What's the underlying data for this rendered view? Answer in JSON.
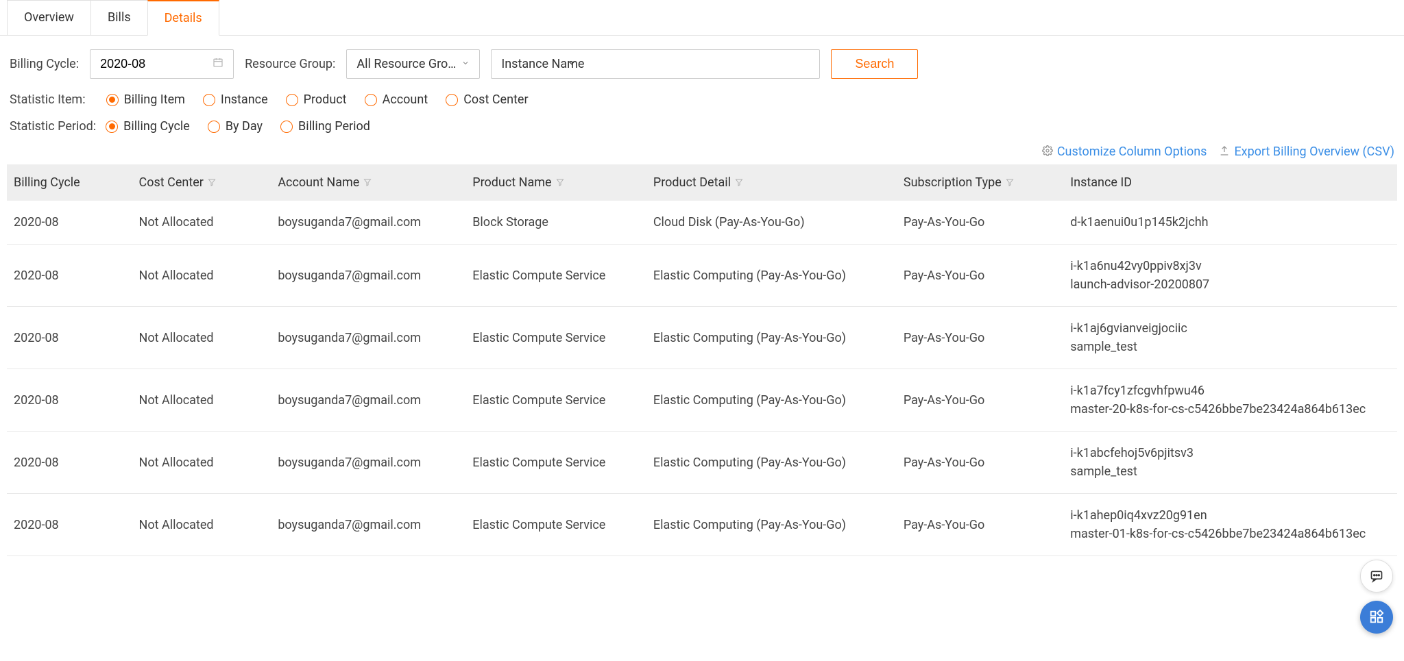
{
  "tabs": {
    "overview": "Overview",
    "bills": "Bills",
    "details": "Details"
  },
  "filters": {
    "billing_cycle_label": "Billing Cycle:",
    "billing_cycle_value": "2020-08",
    "resource_group_label": "Resource Group:",
    "resource_group_value": "All Resource Gro…",
    "instance_name_label": "Instance Name",
    "search_button": "Search"
  },
  "statistic_item": {
    "label": "Statistic Item:",
    "options": {
      "billing_item": "Billing Item",
      "instance": "Instance",
      "product": "Product",
      "account": "Account",
      "cost_center": "Cost Center"
    }
  },
  "statistic_period": {
    "label": "Statistic Period:",
    "options": {
      "billing_cycle": "Billing Cycle",
      "by_day": "By Day",
      "billing_period": "Billing Period"
    }
  },
  "actions": {
    "customize": "Customize Column Options",
    "export_csv": "Export Billing Overview (CSV)"
  },
  "columns": {
    "billing_cycle": "Billing Cycle",
    "cost_center": "Cost Center",
    "account_name": "Account Name",
    "product_name": "Product Name",
    "product_detail": "Product Detail",
    "subscription_type": "Subscription Type",
    "instance_id": "Instance ID"
  },
  "rows": [
    {
      "billing_cycle": "2020-08",
      "cost_center": "Not Allocated",
      "account_name": "boysuganda7@gmail.com",
      "product_name": "Block Storage",
      "product_detail": "Cloud Disk (Pay-As-You-Go)",
      "subscription_type": "Pay-As-You-Go",
      "instance_id": "d-k1aenui0u1p145k2jchh"
    },
    {
      "billing_cycle": "2020-08",
      "cost_center": "Not Allocated",
      "account_name": "boysuganda7@gmail.com",
      "product_name": "Elastic Compute Service",
      "product_detail": "Elastic Computing (Pay-As-You-Go)",
      "subscription_type": "Pay-As-You-Go",
      "instance_id": "i-k1a6nu42vy0ppiv8xj3v\nlaunch-advisor-20200807"
    },
    {
      "billing_cycle": "2020-08",
      "cost_center": "Not Allocated",
      "account_name": "boysuganda7@gmail.com",
      "product_name": "Elastic Compute Service",
      "product_detail": "Elastic Computing (Pay-As-You-Go)",
      "subscription_type": "Pay-As-You-Go",
      "instance_id": "i-k1aj6gvianveigjociic\nsample_test"
    },
    {
      "billing_cycle": "2020-08",
      "cost_center": "Not Allocated",
      "account_name": "boysuganda7@gmail.com",
      "product_name": "Elastic Compute Service",
      "product_detail": "Elastic Computing (Pay-As-You-Go)",
      "subscription_type": "Pay-As-You-Go",
      "instance_id": "i-k1a7fcy1zfcgvhfpwu46\nmaster-20-k8s-for-cs-c5426bbe7be23424a864b613ec"
    },
    {
      "billing_cycle": "2020-08",
      "cost_center": "Not Allocated",
      "account_name": "boysuganda7@gmail.com",
      "product_name": "Elastic Compute Service",
      "product_detail": "Elastic Computing (Pay-As-You-Go)",
      "subscription_type": "Pay-As-You-Go",
      "instance_id": "i-k1abcfehoj5v6pjitsv3\nsample_test"
    },
    {
      "billing_cycle": "2020-08",
      "cost_center": "Not Allocated",
      "account_name": "boysuganda7@gmail.com",
      "product_name": "Elastic Compute Service",
      "product_detail": "Elastic Computing (Pay-As-You-Go)",
      "subscription_type": "Pay-As-You-Go",
      "instance_id": "i-k1ahep0iq4xvz20g91en\nmaster-01-k8s-for-cs-c5426bbe7be23424a864b613ec"
    }
  ]
}
